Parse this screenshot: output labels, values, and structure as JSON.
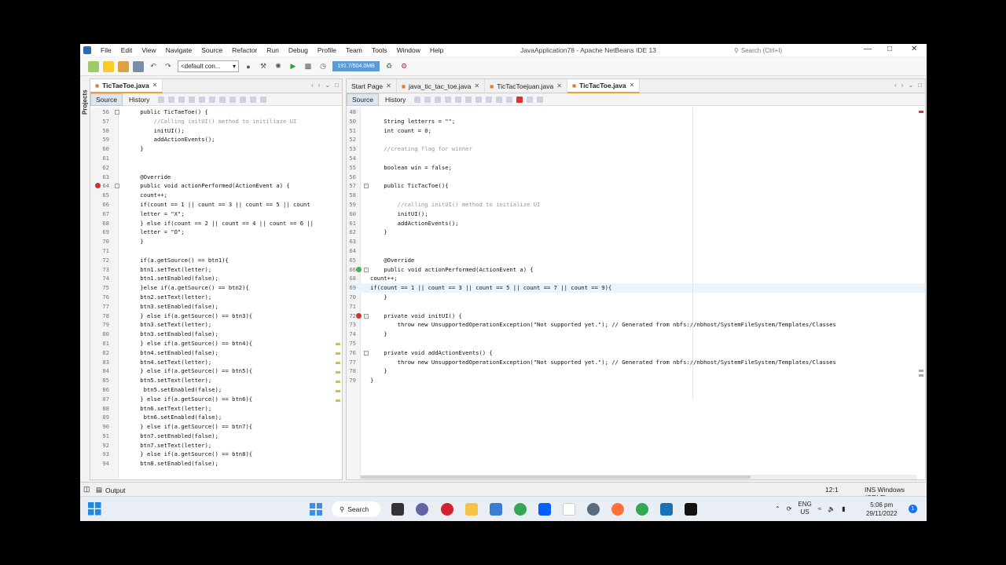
{
  "window": {
    "title": "JavaApplication78 - Apache NetBeans IDE 13",
    "search_placeholder": "Search (Ctrl+I)"
  },
  "menu": [
    "File",
    "Edit",
    "View",
    "Navigate",
    "Source",
    "Refactor",
    "Run",
    "Debug",
    "Profile",
    "Team",
    "Tools",
    "Window",
    "Help"
  ],
  "toolbar": {
    "config": "<default con...",
    "memory": "191.7/504.0MB"
  },
  "sidebar": {
    "projects_label": "Projects"
  },
  "left_editor": {
    "tab": "TicTaeToe.java",
    "source_label": "Source",
    "history_label": "History",
    "lines": [
      {
        "n": "56",
        "t": "    public TicTaeToe() {"
      },
      {
        "n": "57",
        "t": "        //Calling initUI() method to initiliaze UI"
      },
      {
        "n": "58",
        "t": "        initUI();"
      },
      {
        "n": "59",
        "t": "        addActionEvents();"
      },
      {
        "n": "60",
        "t": "    }"
      },
      {
        "n": "61",
        "t": ""
      },
      {
        "n": "62",
        "t": ""
      },
      {
        "n": "63",
        "t": "    @Override"
      },
      {
        "n": "64",
        "t": "    public void actionPerformed(ActionEvent a) {"
      },
      {
        "n": "65",
        "t": "    count++;"
      },
      {
        "n": "66",
        "t": "    if(count == 1 || count == 3 || count == 5 || count"
      },
      {
        "n": "67",
        "t": "    letter = \"X\";"
      },
      {
        "n": "68",
        "t": "    } else if(count == 2 || count == 4 || count == 6 ||"
      },
      {
        "n": "69",
        "t": "    letter = \"O\";"
      },
      {
        "n": "70",
        "t": "    }"
      },
      {
        "n": "71",
        "t": ""
      },
      {
        "n": "72",
        "t": "    if(a.getSource() == btn1){"
      },
      {
        "n": "73",
        "t": "    btn1.setText(letter);"
      },
      {
        "n": "74",
        "t": "    btn1.setEnabled(false);"
      },
      {
        "n": "75",
        "t": "    }else if(a.getSource() == btn2){"
      },
      {
        "n": "76",
        "t": "    btn2.setText(letter);"
      },
      {
        "n": "77",
        "t": "    btn3.setEnabled(false);"
      },
      {
        "n": "78",
        "t": "    } else if(a.getSource() == btn3){"
      },
      {
        "n": "79",
        "t": "    btn3.setText(letter);"
      },
      {
        "n": "80",
        "t": "    btn3.setEnabled(false);"
      },
      {
        "n": "81",
        "t": "    } else if(a.getSource() == btn4){"
      },
      {
        "n": "82",
        "t": "    btn4.setEnabled(false);"
      },
      {
        "n": "83",
        "t": "    btn4.setText(letter);"
      },
      {
        "n": "84",
        "t": "    } else if(a.getSource() == btn5){"
      },
      {
        "n": "85",
        "t": "    btn5.setText(letter);"
      },
      {
        "n": "86",
        "t": "     btn5.setEnabled(false);"
      },
      {
        "n": "87",
        "t": "    } else if(a.getSource() == btn6){"
      },
      {
        "n": "88",
        "t": "    btn6.setText(letter);"
      },
      {
        "n": "89",
        "t": "     btn6.setEnabled(false);"
      },
      {
        "n": "90",
        "t": "    } else if(a.getSource() == btn7){"
      },
      {
        "n": "91",
        "t": "    btn7.setEnabled(false);"
      },
      {
        "n": "92",
        "t": "    btn7.setText(letter);"
      },
      {
        "n": "93",
        "t": "    } else if(a.getSource() == btn8){"
      },
      {
        "n": "94",
        "t": "    btn8.setEnabled(false);"
      }
    ]
  },
  "right_editor": {
    "tabs": [
      {
        "label": "Start Page"
      },
      {
        "label": "java_tic_tac_toe.java"
      },
      {
        "label": "TicTacToejuan.java"
      },
      {
        "label": "TicTacToe.java"
      }
    ],
    "source_label": "Source",
    "history_label": "History",
    "lines": [
      {
        "n": "48",
        "t": ""
      },
      {
        "n": "50",
        "t": "    String letterrs = \"\";"
      },
      {
        "n": "51",
        "t": "    int count = 0;"
      },
      {
        "n": "52",
        "t": ""
      },
      {
        "n": "53",
        "t": "    //creating flag for winner"
      },
      {
        "n": "54",
        "t": ""
      },
      {
        "n": "55",
        "t": "    boolean win = false;"
      },
      {
        "n": "56",
        "t": ""
      },
      {
        "n": "57",
        "t": "    public TicTacToe(){"
      },
      {
        "n": "58",
        "t": ""
      },
      {
        "n": "59",
        "t": "        //calling initUI() method to initialize UI"
      },
      {
        "n": "60",
        "t": "        initUI();"
      },
      {
        "n": "61",
        "t": "        addActionEvents();"
      },
      {
        "n": "62",
        "t": "    }"
      },
      {
        "n": "63",
        "t": ""
      },
      {
        "n": "64",
        "t": ""
      },
      {
        "n": "65",
        "t": "    @Override"
      },
      {
        "n": "66",
        "t": "    public void actionPerformed(ActionEvent a) {"
      },
      {
        "n": "68",
        "t": "count++;"
      },
      {
        "n": "69",
        "t": "if(count == 1 || count == 3 || count == 5 || count == 7 || count == 9){"
      },
      {
        "n": "70",
        "t": "    }"
      },
      {
        "n": "71",
        "t": ""
      },
      {
        "n": "72",
        "t": "    private void initUI() {"
      },
      {
        "n": "73",
        "t": "        throw new UnsupportedOperationException(\"Not supported yet.\"); // Generated from nbfs://nbhost/SystemFileSystem/Templates/Classes"
      },
      {
        "n": "74",
        "t": "    }"
      },
      {
        "n": "75",
        "t": ""
      },
      {
        "n": "76",
        "t": "    private void addActionEvents() {"
      },
      {
        "n": "77",
        "t": "        throw new UnsupportedOperationException(\"Not supported yet.\"); // Generated from nbfs://nbhost/SystemFileSystem/Templates/Classes"
      },
      {
        "n": "78",
        "t": "    }"
      },
      {
        "n": "79",
        "t": "}"
      }
    ]
  },
  "status": {
    "output": "Output",
    "position": "12:1",
    "mode": "INS Windows (CRLF)"
  },
  "taskbar": {
    "search": "Search",
    "lang_1": "ENG",
    "lang_2": "US",
    "time": "5:06 pm",
    "date": "29/11/2022",
    "notifications": "1"
  }
}
